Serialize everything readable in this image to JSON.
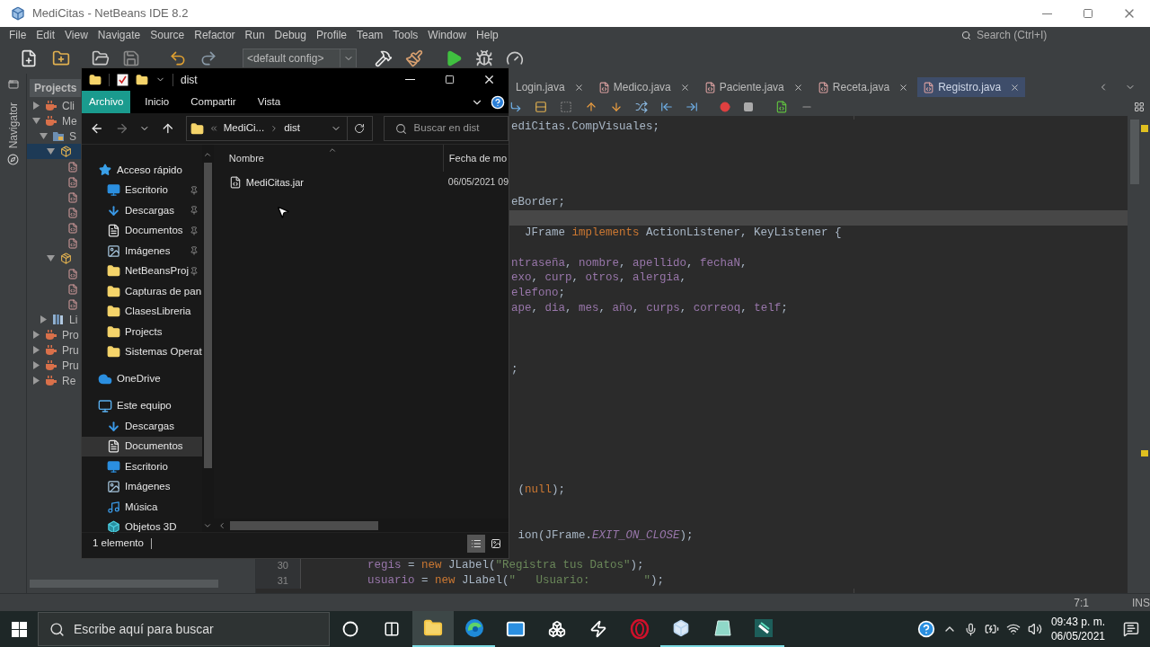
{
  "window": {
    "title": "MediCitas - NetBeans IDE 8.2"
  },
  "menu": [
    "File",
    "Edit",
    "View",
    "Navigate",
    "Source",
    "Refactor",
    "Run",
    "Debug",
    "Profile",
    "Team",
    "Tools",
    "Window",
    "Help"
  ],
  "search": {
    "placeholder": "Search (Ctrl+I)"
  },
  "toolbar": {
    "config": "<default config>"
  },
  "navigator": {
    "label": "Navigator"
  },
  "projects": {
    "title": "Projects",
    "tree": [
      {
        "label": "Cli",
        "kind": "project",
        "expanded": false,
        "selected": false
      },
      {
        "label": "Me",
        "kind": "project",
        "expanded": true,
        "selected": false,
        "children": [
          {
            "label": "S",
            "kind": "sources",
            "expanded": true,
            "selected": false,
            "children": [
              {
                "kind": "package",
                "expanded": true,
                "selected": true,
                "children": [
                  {
                    "kind": "form",
                    "selected": false
                  },
                  {
                    "kind": "form",
                    "selected": false
                  },
                  {
                    "kind": "form",
                    "selected": false
                  },
                  {
                    "kind": "form",
                    "selected": false
                  },
                  {
                    "kind": "form",
                    "selected": false
                  },
                  {
                    "kind": "form",
                    "selected": false
                  }
                ]
              },
              {
                "kind": "package",
                "expanded": true,
                "selected": false,
                "children": [
                  {
                    "kind": "form",
                    "selected": false
                  },
                  {
                    "kind": "form",
                    "selected": false
                  },
                  {
                    "kind": "form",
                    "selected": false
                  }
                ]
              }
            ]
          },
          {
            "label": "Li",
            "kind": "libraries",
            "expanded": false,
            "selected": false
          }
        ]
      },
      {
        "label": "Pro",
        "kind": "project",
        "expanded": false,
        "selected": false
      },
      {
        "label": "Pru",
        "kind": "project",
        "expanded": false,
        "selected": false
      },
      {
        "label": "Pru",
        "kind": "project",
        "expanded": false,
        "selected": false
      },
      {
        "label": "Re",
        "kind": "project",
        "expanded": false,
        "selected": false
      }
    ]
  },
  "editor": {
    "tabs": [
      {
        "label": "Login.java",
        "selected": false,
        "icon": false
      },
      {
        "label": "Medico.java",
        "selected": false,
        "icon": true
      },
      {
        "label": "Paciente.java",
        "selected": false,
        "icon": true
      },
      {
        "label": "Receta.java",
        "selected": false,
        "icon": true
      },
      {
        "label": "Registro.java",
        "selected": true,
        "icon": true
      }
    ],
    "lines": [
      {
        "current": false,
        "tokens": [
          {
            "text": "ediCitas.CompVisuales;",
            "kind": "plain"
          }
        ]
      },
      {
        "current": false
      },
      {
        "current": false
      },
      {
        "current": false
      },
      {
        "current": false
      },
      {
        "current": false,
        "tokens": [
          {
            "text": "eBorder;",
            "kind": "plain"
          }
        ]
      },
      {
        "current": true
      },
      {
        "current": false,
        "tokens": [
          {
            "text": "  JFrame ",
            "kind": "plain"
          },
          {
            "text": "implements",
            "kind": "keyword"
          },
          {
            "text": " ActionListener, KeyListener {",
            "kind": "plain"
          }
        ]
      },
      {
        "current": false
      },
      {
        "current": false,
        "tokens": [
          {
            "text": "ntraseña",
            "kind": "field"
          },
          {
            "text": ", ",
            "kind": "plain"
          },
          {
            "text": "nombre",
            "kind": "field"
          },
          {
            "text": ", ",
            "kind": "plain"
          },
          {
            "text": "apellido",
            "kind": "field"
          },
          {
            "text": ", ",
            "kind": "plain"
          },
          {
            "text": "fechaN",
            "kind": "field"
          },
          {
            "text": ",",
            "kind": "plain"
          }
        ]
      },
      {
        "current": false,
        "tokens": [
          {
            "text": "exo",
            "kind": "field"
          },
          {
            "text": ", ",
            "kind": "plain"
          },
          {
            "text": "curp",
            "kind": "field"
          },
          {
            "text": ", ",
            "kind": "plain"
          },
          {
            "text": "otros",
            "kind": "field"
          },
          {
            "text": ", ",
            "kind": "plain"
          },
          {
            "text": "alergia",
            "kind": "field"
          },
          {
            "text": ",",
            "kind": "plain"
          }
        ]
      },
      {
        "current": false,
        "tokens": [
          {
            "text": "elefono",
            "kind": "field"
          },
          {
            "text": ";",
            "kind": "plain"
          }
        ]
      },
      {
        "current": false,
        "tokens": [
          {
            "text": "ape",
            "kind": "field"
          },
          {
            "text": ", ",
            "kind": "plain"
          },
          {
            "text": "dia",
            "kind": "field"
          },
          {
            "text": ", ",
            "kind": "plain"
          },
          {
            "text": "mes",
            "kind": "field"
          },
          {
            "text": ", ",
            "kind": "plain"
          },
          {
            "text": "año",
            "kind": "field"
          },
          {
            "text": ", ",
            "kind": "plain"
          },
          {
            "text": "curps",
            "kind": "field"
          },
          {
            "text": ", ",
            "kind": "plain"
          },
          {
            "text": "correoq",
            "kind": "field"
          },
          {
            "text": ", ",
            "kind": "plain"
          },
          {
            "text": "telf",
            "kind": "field"
          },
          {
            "text": ";",
            "kind": "plain"
          }
        ]
      },
      {
        "current": false
      },
      {
        "current": false
      },
      {
        "current": false
      },
      {
        "current": false,
        "tokens": [
          {
            "text": ";",
            "kind": "plain"
          }
        ]
      },
      {
        "current": false
      },
      {
        "current": false
      },
      {
        "current": false
      },
      {
        "current": false
      },
      {
        "current": false
      },
      {
        "current": false
      },
      {
        "current": false
      },
      {
        "current": false,
        "tokens": [
          {
            "text": " (",
            "kind": "plain"
          },
          {
            "text": "null",
            "kind": "keyword"
          },
          {
            "text": ");",
            "kind": "plain"
          }
        ]
      },
      {
        "current": false
      },
      {
        "current": false
      },
      {
        "current": false,
        "tokens": [
          {
            "text": " ion(JFrame.",
            "kind": "plain"
          },
          {
            "text": "EXIT_ON_CLOSE",
            "kind": "constant"
          },
          {
            "text": ");",
            "kind": "plain"
          }
        ]
      },
      {
        "current": false
      },
      {
        "current": false,
        "number": "30",
        "tokens": [
          {
            "text": "regis",
            "kind": "field"
          },
          {
            "text": " = ",
            "kind": "plain"
          },
          {
            "text": "new",
            "kind": "keyword"
          },
          {
            "text": " JLabel(",
            "kind": "plain"
          },
          {
            "text": "\"Registra tus Datos\"",
            "kind": "string"
          },
          {
            "text": ");",
            "kind": "plain"
          }
        ]
      },
      {
        "current": false,
        "number": "31",
        "tokens": [
          {
            "text": "usuario",
            "kind": "field"
          },
          {
            "text": " = ",
            "kind": "plain"
          },
          {
            "text": "new",
            "kind": "keyword"
          },
          {
            "text": " JLabel(",
            "kind": "plain"
          },
          {
            "text": "\"   Usuario:        \"",
            "kind": "string"
          },
          {
            "text": ");",
            "kind": "plain"
          }
        ]
      }
    ],
    "caret": "7:1",
    "mode": "INS"
  },
  "explorer": {
    "title": "dist",
    "ribbon": [
      {
        "label": "Archivo",
        "selected": true
      },
      {
        "label": "Inicio",
        "selected": false
      },
      {
        "label": "Compartir",
        "selected": false
      },
      {
        "label": "Vista",
        "selected": false
      }
    ],
    "nav_buttons": [
      {
        "kind": "back",
        "disabled": false
      },
      {
        "kind": "forward",
        "disabled": true
      },
      {
        "kind": "recent",
        "disabled": false
      },
      {
        "kind": "up",
        "disabled": false
      }
    ],
    "breadcrumbs": [
      "MediCi...",
      "dist"
    ],
    "search": {
      "placeholder": "Buscar en dist"
    },
    "nav": [
      {
        "label": "Acceso rápido",
        "kind": "star",
        "selected": false,
        "children": [
          {
            "label": "Escritorio",
            "kind": "desktop",
            "pinned": true,
            "selected": false
          },
          {
            "label": "Descargas",
            "kind": "download",
            "pinned": true,
            "selected": false
          },
          {
            "label": "Documentos",
            "kind": "document",
            "pinned": true,
            "selected": false
          },
          {
            "label": "Imágenes",
            "kind": "pictures",
            "pinned": true,
            "selected": false
          },
          {
            "label": "NetBeansProj",
            "kind": "folder",
            "pinned": true,
            "selected": false
          },
          {
            "label": "Capturas de pan",
            "kind": "folder",
            "pinned": false,
            "selected": false
          },
          {
            "label": "ClasesLibreria",
            "kind": "folder",
            "pinned": false,
            "selected": false
          },
          {
            "label": "Projects",
            "kind": "folder",
            "pinned": false,
            "selected": false
          },
          {
            "label": "Sistemas Operat",
            "kind": "folder",
            "pinned": false,
            "selected": false
          }
        ]
      },
      {
        "label": "OneDrive",
        "kind": "cloud",
        "selected": false
      },
      {
        "label": "Este equipo",
        "kind": "pc",
        "selected": false,
        "children": [
          {
            "label": "Descargas",
            "kind": "download",
            "pinned": false,
            "selected": false
          },
          {
            "label": "Documentos",
            "kind": "document",
            "pinned": false,
            "selected": true
          },
          {
            "label": "Escritorio",
            "kind": "desktop",
            "pinned": false,
            "selected": false
          },
          {
            "label": "Imágenes",
            "kind": "pictures",
            "pinned": false,
            "selected": false
          },
          {
            "label": "Música",
            "kind": "music",
            "pinned": false,
            "selected": false
          },
          {
            "label": "Objetos 3D",
            "kind": "objects",
            "pinned": false,
            "selected": false
          }
        ]
      }
    ],
    "columns": [
      "Nombre",
      "Fecha de mo"
    ],
    "files": [
      {
        "name": "MediCitas.jar",
        "date": "06/05/2021 09",
        "selected": false
      }
    ],
    "status": "1 elemento",
    "views": [
      {
        "kind": "details",
        "selected": true
      },
      {
        "kind": "tiles",
        "selected": false
      }
    ]
  },
  "taskbar": {
    "search": {
      "placeholder": "Escribe aquí para buscar"
    },
    "apps": [
      {
        "kind": "cortana",
        "running": false,
        "selected": false
      },
      {
        "kind": "taskview",
        "running": false,
        "selected": false
      },
      {
        "kind": "explorer",
        "running": true,
        "selected": true
      },
      {
        "kind": "edge",
        "running": true,
        "selected": false
      },
      {
        "kind": "mail",
        "running": false,
        "selected": false
      },
      {
        "kind": "dropbox",
        "running": false,
        "selected": false
      },
      {
        "kind": "bolt",
        "running": false,
        "selected": false
      },
      {
        "kind": "opera",
        "running": false,
        "selected": false
      },
      {
        "kind": "cube",
        "running": true,
        "selected": false
      },
      {
        "kind": "notes",
        "running": true,
        "selected": false
      },
      {
        "kind": "editor",
        "running": true,
        "selected": false
      }
    ],
    "time": "09:43 p. m.",
    "date": "06/05/2021"
  }
}
